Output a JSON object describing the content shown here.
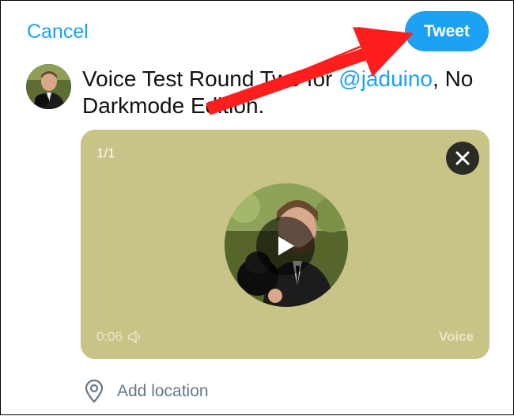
{
  "header": {
    "cancel_label": "Cancel",
    "tweet_label": "Tweet"
  },
  "composer": {
    "text_before": "Voice Test Round Two for ",
    "mention": "@jaduino",
    "text_after": ", No Darkmode Edition."
  },
  "media": {
    "counter": "1/1",
    "duration": "0:06",
    "type_label": "Voice",
    "icons": [
      "close-icon",
      "play-icon",
      "speaker-icon"
    ]
  },
  "footer": {
    "location_label": "Add location",
    "location_icon": "location-pin-icon"
  },
  "colors": {
    "accent": "#1da1f2",
    "media_background": "#c8c386",
    "annotation_arrow": "#ff1e1e"
  }
}
